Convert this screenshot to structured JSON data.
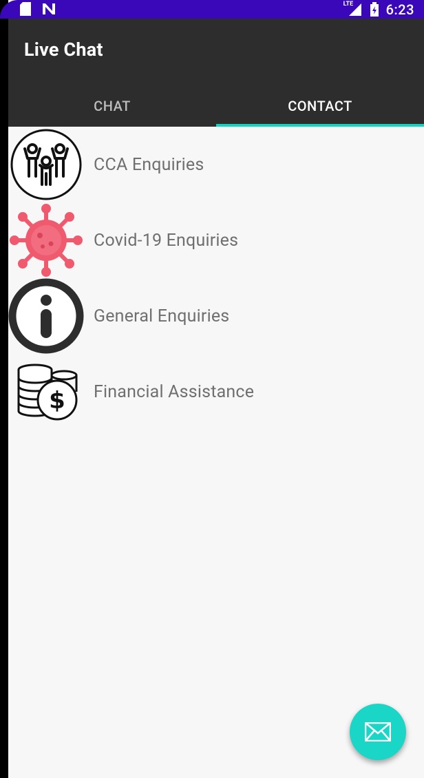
{
  "status_bar": {
    "time": "6:23",
    "network": "LTE",
    "icons": [
      "sd-card-icon",
      "n-notification-icon",
      "lte-signal-icon",
      "battery-charging-icon"
    ]
  },
  "app_bar": {
    "title": "Live Chat"
  },
  "tabs": [
    {
      "label": "CHAT",
      "active": false
    },
    {
      "label": "CONTACT",
      "active": true
    }
  ],
  "contacts": [
    {
      "label": "CCA Enquiries",
      "icon": "people-group-icon"
    },
    {
      "label": "Covid-19 Enquiries",
      "icon": "virus-icon"
    },
    {
      "label": "General Enquiries",
      "icon": "info-icon"
    },
    {
      "label": "Financial Assistance",
      "icon": "coins-dollar-icon"
    }
  ],
  "fab": {
    "icon": "mail-icon"
  },
  "colors": {
    "status_bar": "#3a08b8",
    "app_bar": "#2d2d2d",
    "accent": "#1ad1c1",
    "background": "#f7f7f7",
    "virus": "#ef5a6f"
  }
}
